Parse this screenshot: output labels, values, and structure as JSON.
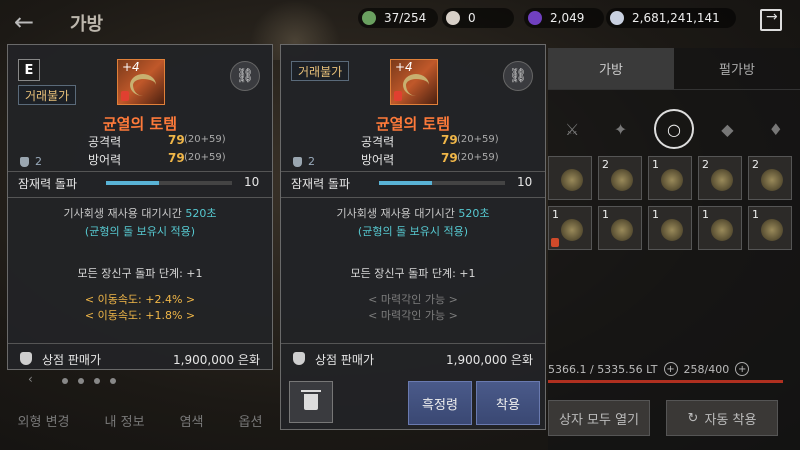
{
  "header": {
    "title": "가방",
    "currencies": [
      {
        "icon": "green-orb-icon",
        "value": "37/254",
        "color": "#6aa060"
      },
      {
        "icon": "pearl-icon",
        "value": "0",
        "color": "#d8d0c8"
      },
      {
        "icon": "purple-gem-icon",
        "value": "2,049",
        "color": "#7040c0"
      },
      {
        "icon": "silver-coin-icon",
        "value": "2,681,241,141",
        "color": "#c8d0e0"
      }
    ]
  },
  "inventory": {
    "tabs": [
      "가방",
      "펄가방"
    ],
    "lt": "5366.1 / 5335.56 LT",
    "slots_count": "258/400",
    "open_all": "상자 모두 열기",
    "auto_equip": "자동 착용",
    "slot_numbers": [
      "",
      "2",
      "1",
      "2",
      "2",
      "1",
      "1",
      "1",
      "1",
      "1"
    ]
  },
  "bottom_tabs": [
    "외형 변경",
    "내 정보",
    "염색",
    "옵션"
  ],
  "item_left": {
    "grade": "E",
    "trade": "거래불가",
    "enhance": "+4",
    "name": "균열의 토템",
    "stats": [
      {
        "label": "공격력",
        "value": "79",
        "detail": "(20+59)"
      },
      {
        "label": "방어력",
        "value": "79",
        "detail": "(20+59)"
      }
    ],
    "bag_count": "2",
    "potential_label": "잠재력 돌파",
    "potential_value": "10",
    "potential_fill": 0.42,
    "cooldown_prefix": "기사회생 재사용 대기시간",
    "cooldown_value": "520초",
    "stone_note": "(균형의 돌 보유시 적용)",
    "breakthrough": "모든 장신구 돌파 단계: +1",
    "engrave": [
      "< 이동속도: +2.4% >",
      "< 이동속도: +1.8% >"
    ],
    "sale_label": "상점 판매가",
    "sale_value": "1,900,000 은화"
  },
  "item_right": {
    "trade": "거래불가",
    "enhance": "+4",
    "name": "균열의 토템",
    "stats": [
      {
        "label": "공격력",
        "value": "79",
        "detail": "(20+59)"
      },
      {
        "label": "방어력",
        "value": "79",
        "detail": "(20+59)"
      }
    ],
    "bag_count": "2",
    "potential_label": "잠재력 돌파",
    "potential_value": "10",
    "potential_fill": 0.42,
    "cooldown_prefix": "기사회생 재사용 대기시간",
    "cooldown_value": "520초",
    "stone_note": "(균형의 돌 보유시 적용)",
    "breakthrough": "모든 장신구 돌파 단계: +1",
    "engrave": [
      "< 마력각인 가능 >",
      "< 마력각인 가능 >"
    ],
    "sale_label": "상점 판매가",
    "sale_value": "1,900,000 은화",
    "btn_black_spirit": "흑정령",
    "btn_equip": "착용"
  }
}
